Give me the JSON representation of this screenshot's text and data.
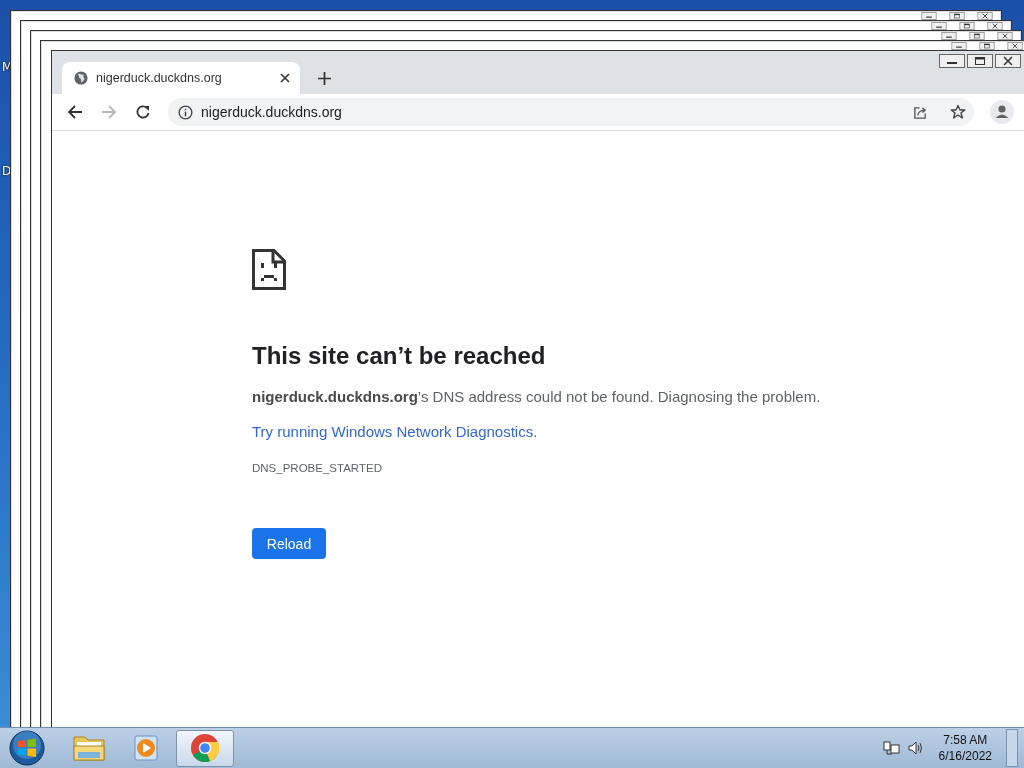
{
  "desktop": {
    "icon_labels": [
      "M",
      "D"
    ]
  },
  "browser": {
    "tabs": [
      {
        "title": "nigerduck.duckdns.org",
        "selected": true
      }
    ],
    "forward_enabled": false,
    "address": "nigerduck.duckdns.org"
  },
  "error_page": {
    "heading": "This site can’t be reached",
    "message": "**nigerduck.duckdns.org**’s DNS address could not be found. Diagnosing the problem.",
    "link": "Try running Windows Network Diagnostics.",
    "code": "DNS_PROBE_STARTED",
    "button": "Reload"
  },
  "taskbar": {
    "apps": [
      {
        "kind": "explorer",
        "selected": false
      },
      {
        "kind": "media",
        "selected": false
      },
      {
        "kind": "chrome",
        "selected": true
      }
    ],
    "time": "7:58 AM",
    "date": "6/16/2022"
  }
}
